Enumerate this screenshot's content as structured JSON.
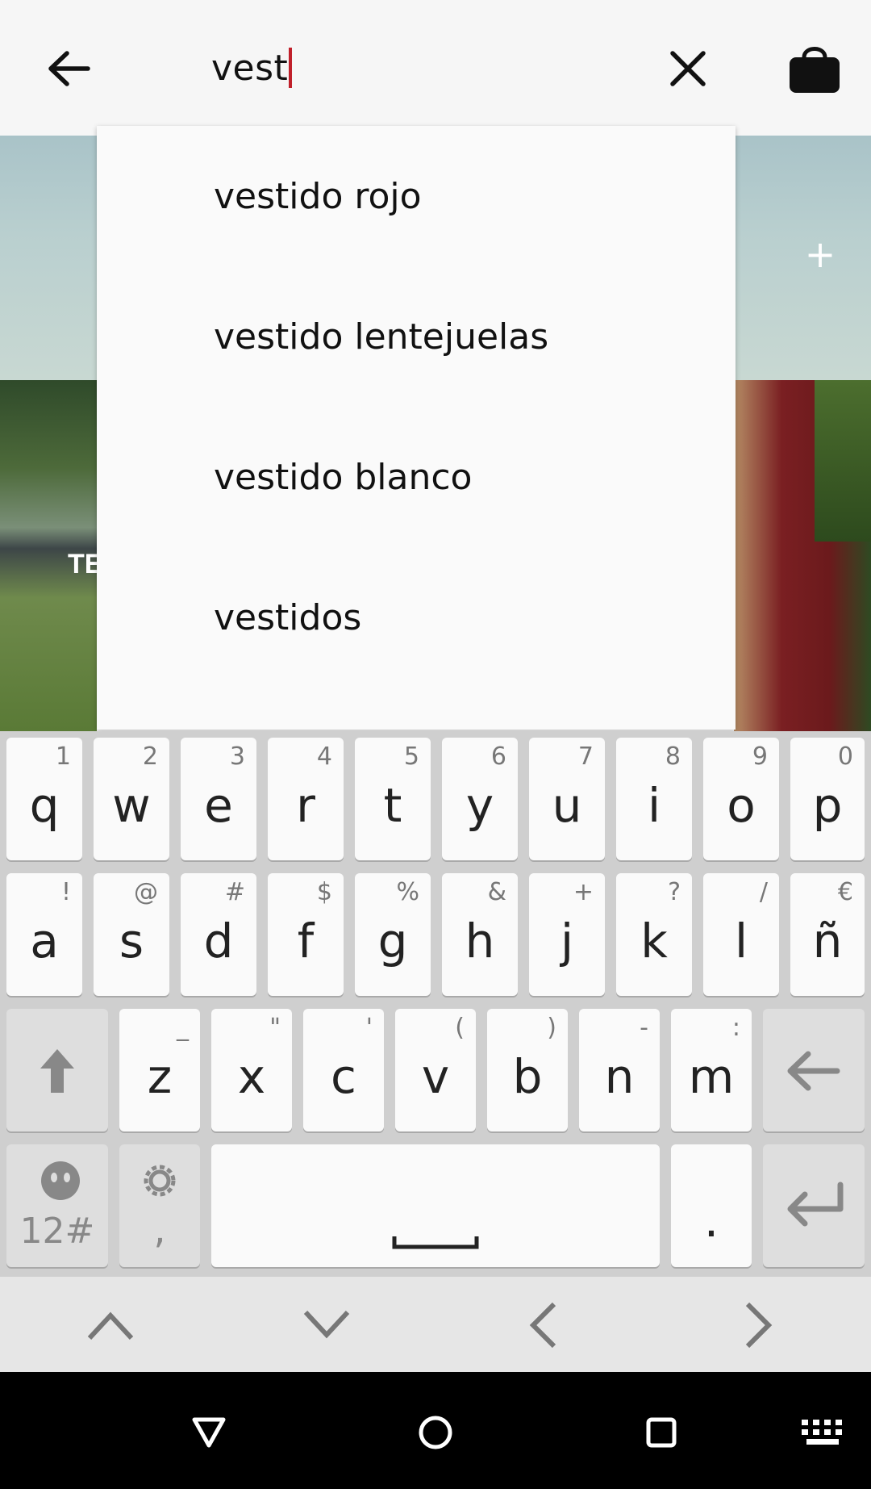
{
  "search": {
    "query": "vest"
  },
  "banner": {
    "left_photo_text": "TE"
  },
  "suggestions": [
    "vestido rojo",
    "vestido lentejuelas",
    "vestido blanco",
    "vestidos"
  ],
  "keyboard": {
    "row1": [
      {
        "key": "q",
        "hint": "1"
      },
      {
        "key": "w",
        "hint": "2"
      },
      {
        "key": "e",
        "hint": "3"
      },
      {
        "key": "r",
        "hint": "4"
      },
      {
        "key": "t",
        "hint": "5"
      },
      {
        "key": "y",
        "hint": "6"
      },
      {
        "key": "u",
        "hint": "7"
      },
      {
        "key": "i",
        "hint": "8"
      },
      {
        "key": "o",
        "hint": "9"
      },
      {
        "key": "p",
        "hint": "0"
      }
    ],
    "row2": [
      {
        "key": "a",
        "hint": "!"
      },
      {
        "key": "s",
        "hint": "@"
      },
      {
        "key": "d",
        "hint": "#"
      },
      {
        "key": "f",
        "hint": "$"
      },
      {
        "key": "g",
        "hint": "%"
      },
      {
        "key": "h",
        "hint": "&"
      },
      {
        "key": "j",
        "hint": "+"
      },
      {
        "key": "k",
        "hint": "?"
      },
      {
        "key": "l",
        "hint": "/"
      },
      {
        "key": "ñ",
        "hint": "€"
      }
    ],
    "row3": [
      {
        "key": "z",
        "hint": "_"
      },
      {
        "key": "x",
        "hint": "\""
      },
      {
        "key": "c",
        "hint": "'"
      },
      {
        "key": "v",
        "hint": "("
      },
      {
        "key": "b",
        "hint": ")"
      },
      {
        "key": "n",
        "hint": "-"
      },
      {
        "key": "m",
        "hint": ":"
      }
    ],
    "symbols_label": "12#",
    "comma_label": ",",
    "period_label": "."
  },
  "icons": {
    "back": "arrow-left-icon",
    "clear": "close-icon",
    "bag": "shopping-bag-icon",
    "shift": "shift-arrow-icon",
    "backspace": "backspace-arrow-icon",
    "emoji": "emoji-icon",
    "settings": "gear-icon",
    "space": "space-bar-icon",
    "enter": "enter-icon"
  },
  "colors": {
    "caret": "#c0202a",
    "topbar": "#f6f6f6",
    "keyboard_bg": "#cfcfcf"
  }
}
